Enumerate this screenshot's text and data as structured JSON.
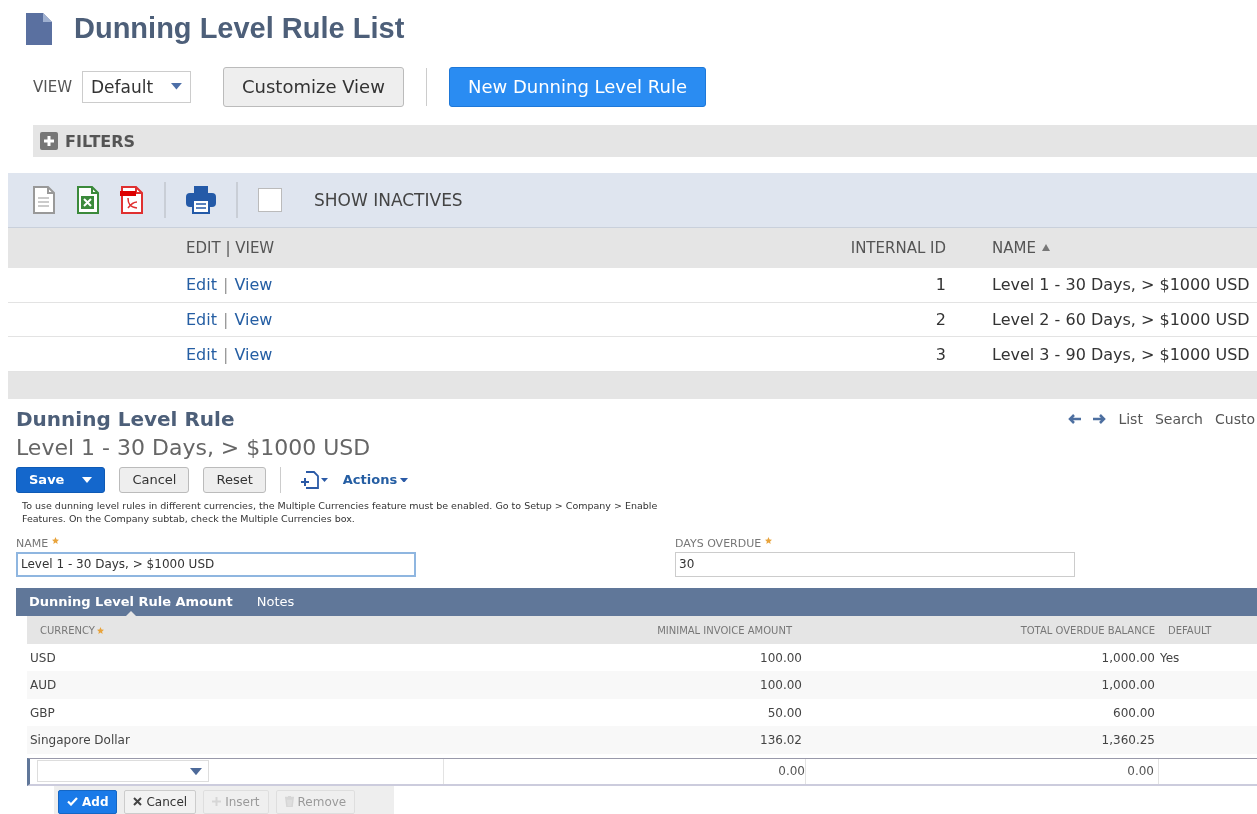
{
  "page": {
    "title": "Dunning Level Rule List"
  },
  "view_bar": {
    "label": "VIEW",
    "view_select": "Default",
    "buttons": [
      {
        "label": "Customize View",
        "kind": "secondary"
      },
      {
        "label": "New Dunning Level Rule",
        "kind": "primary"
      }
    ]
  },
  "filters": {
    "label": "FILTERS",
    "expanded": false
  },
  "list_toolbar": {
    "show_inactives": {
      "label": "SHOW INACTIVES",
      "checked": false
    }
  },
  "list_table": {
    "columns": [
      {
        "label": "EDIT | VIEW",
        "sorted": false
      },
      {
        "label": "INTERNAL ID",
        "sorted": false
      },
      {
        "label": "NAME",
        "sorted": true
      }
    ],
    "rows": [
      {
        "edit": "Edit",
        "separator": "|",
        "view": "View",
        "internal_id": "1",
        "name": "Level 1 - 30 Days, > $1000 USD"
      },
      {
        "edit": "Edit",
        "separator": "|",
        "view": "View",
        "internal_id": "2",
        "name": "Level 2 - 60 Days, > $1000 USD"
      },
      {
        "edit": "Edit",
        "separator": "|",
        "view": "View",
        "internal_id": "3",
        "name": "Level 3 - 90 Days, > $1000 USD"
      }
    ]
  },
  "record": {
    "type_title": "Dunning Level Rule",
    "record_title": "Level 1 - 30 Days, > $1000 USD",
    "nav": [
      "List",
      "Search",
      "Custo"
    ],
    "buttons": [
      {
        "label": "Save",
        "kind": "primary"
      },
      {
        "label": "Cancel",
        "kind": "secondary"
      },
      {
        "label": "Reset",
        "kind": "secondary"
      }
    ],
    "actions": "Actions",
    "note": "To use dunning level rules in different currencies, the Multiple Currencies feature must be enabled. Go to Setup > Company > Enable Features. On the Company subtab, check the Multiple Currencies box.",
    "fields": [
      {
        "label": "NAME",
        "required": true,
        "value": "Level 1 - 30 Days, > $1000 USD",
        "focused": true
      },
      {
        "label": "DAYS OVERDUE",
        "required": true,
        "value": "30",
        "focused": false
      }
    ],
    "subtabs": [
      {
        "label": "Dunning Level Rule Amount",
        "selected": true
      },
      {
        "label": "Notes",
        "selected": false
      }
    ],
    "amounts": {
      "columns": [
        {
          "label": "CURRENCY",
          "required": true
        },
        {
          "label": "MINIMAL INVOICE AMOUNT",
          "required": false
        },
        {
          "label": "TOTAL OVERDUE BALANCE",
          "required": false
        },
        {
          "label": "DEFAULT",
          "required": false
        }
      ],
      "rows": [
        {
          "currency": "USD",
          "minimal_invoice_amount": "100.00",
          "total_overdue_balance": "1,000.00",
          "default": "Yes"
        },
        {
          "currency": "AUD",
          "minimal_invoice_amount": "100.00",
          "total_overdue_balance": "1,000.00"
        },
        {
          "currency": "GBP",
          "minimal_invoice_amount": "50.00",
          "total_overdue_balance": "600.00"
        },
        {
          "currency": "Singapore Dollar",
          "minimal_invoice_amount": "136.02",
          "total_overdue_balance": "1,360.25"
        }
      ],
      "entry_row": {
        "minimal_invoice_amount": "0.00",
        "total_overdue_balance": "0.00"
      },
      "buttons": [
        {
          "label": "Add",
          "kind": "primary",
          "disabled": false
        },
        {
          "label": "Cancel",
          "kind": "secondary",
          "disabled": false
        },
        {
          "label": "Insert",
          "kind": "secondary",
          "disabled": true
        },
        {
          "label": "Remove",
          "kind": "secondary",
          "disabled": true
        }
      ]
    }
  }
}
